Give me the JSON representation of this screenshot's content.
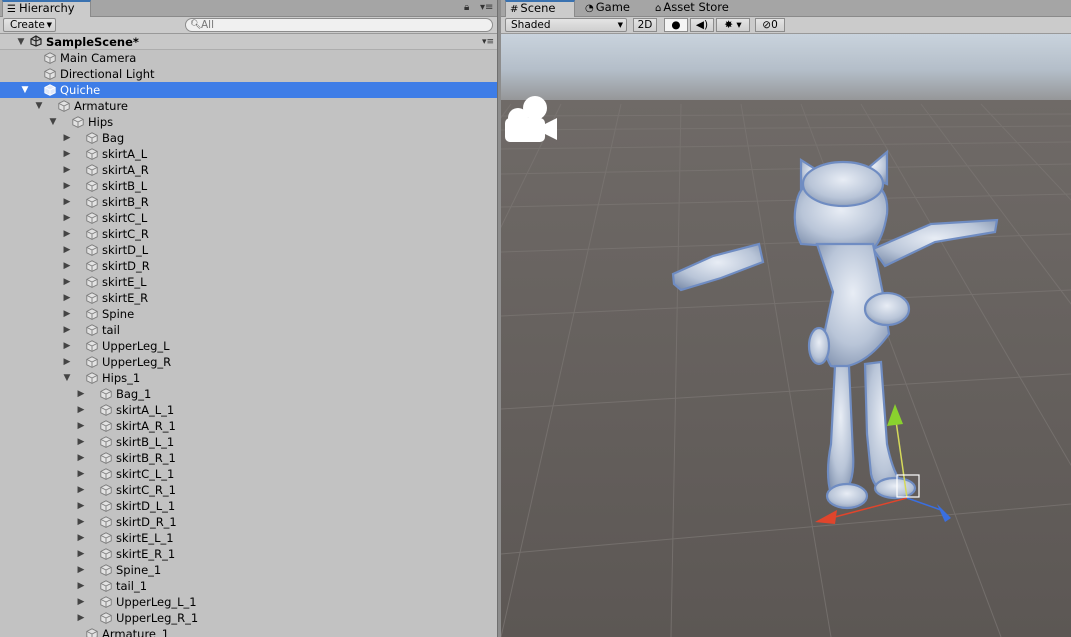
{
  "hierarchy": {
    "tab_label": "Hierarchy",
    "create_label": "Create",
    "search_placeholder": "All",
    "scene_name": "SampleScene*",
    "items": [
      {
        "label": "Main Camera",
        "depth": 1,
        "arrow": "none",
        "selected": false
      },
      {
        "label": "Directional Light",
        "depth": 1,
        "arrow": "none",
        "selected": false
      },
      {
        "label": "Quiche",
        "depth": 1,
        "arrow": "down",
        "selected": true
      },
      {
        "label": "Armature",
        "depth": 2,
        "arrow": "down",
        "selected": false
      },
      {
        "label": "Hips",
        "depth": 3,
        "arrow": "down",
        "selected": false
      },
      {
        "label": "Bag",
        "depth": 4,
        "arrow": "right",
        "selected": false
      },
      {
        "label": "skirtA_L",
        "depth": 4,
        "arrow": "right",
        "selected": false
      },
      {
        "label": "skirtA_R",
        "depth": 4,
        "arrow": "right",
        "selected": false
      },
      {
        "label": "skirtB_L",
        "depth": 4,
        "arrow": "right",
        "selected": false
      },
      {
        "label": "skirtB_R",
        "depth": 4,
        "arrow": "right",
        "selected": false
      },
      {
        "label": "skirtC_L",
        "depth": 4,
        "arrow": "right",
        "selected": false
      },
      {
        "label": "skirtC_R",
        "depth": 4,
        "arrow": "right",
        "selected": false
      },
      {
        "label": "skirtD_L",
        "depth": 4,
        "arrow": "right",
        "selected": false
      },
      {
        "label": "skirtD_R",
        "depth": 4,
        "arrow": "right",
        "selected": false
      },
      {
        "label": "skirtE_L",
        "depth": 4,
        "arrow": "right",
        "selected": false
      },
      {
        "label": "skirtE_R",
        "depth": 4,
        "arrow": "right",
        "selected": false
      },
      {
        "label": "Spine",
        "depth": 4,
        "arrow": "right",
        "selected": false
      },
      {
        "label": "tail",
        "depth": 4,
        "arrow": "right",
        "selected": false
      },
      {
        "label": "UpperLeg_L",
        "depth": 4,
        "arrow": "right",
        "selected": false
      },
      {
        "label": "UpperLeg_R",
        "depth": 4,
        "arrow": "right",
        "selected": false
      },
      {
        "label": "Hips_1",
        "depth": 4,
        "arrow": "down",
        "selected": false
      },
      {
        "label": "Bag_1",
        "depth": 5,
        "arrow": "right",
        "selected": false
      },
      {
        "label": "skirtA_L_1",
        "depth": 5,
        "arrow": "right",
        "selected": false
      },
      {
        "label": "skirtA_R_1",
        "depth": 5,
        "arrow": "right",
        "selected": false
      },
      {
        "label": "skirtB_L_1",
        "depth": 5,
        "arrow": "right",
        "selected": false
      },
      {
        "label": "skirtB_R_1",
        "depth": 5,
        "arrow": "right",
        "selected": false
      },
      {
        "label": "skirtC_L_1",
        "depth": 5,
        "arrow": "right",
        "selected": false
      },
      {
        "label": "skirtC_R_1",
        "depth": 5,
        "arrow": "right",
        "selected": false
      },
      {
        "label": "skirtD_L_1",
        "depth": 5,
        "arrow": "right",
        "selected": false
      },
      {
        "label": "skirtD_R_1",
        "depth": 5,
        "arrow": "right",
        "selected": false
      },
      {
        "label": "skirtE_L_1",
        "depth": 5,
        "arrow": "right",
        "selected": false
      },
      {
        "label": "skirtE_R_1",
        "depth": 5,
        "arrow": "right",
        "selected": false
      },
      {
        "label": "Spine_1",
        "depth": 5,
        "arrow": "right",
        "selected": false
      },
      {
        "label": "tail_1",
        "depth": 5,
        "arrow": "right",
        "selected": false
      },
      {
        "label": "UpperLeg_L_1",
        "depth": 5,
        "arrow": "right",
        "selected": false
      },
      {
        "label": "UpperLeg_R_1",
        "depth": 5,
        "arrow": "right",
        "selected": false
      },
      {
        "label": "Armature_1",
        "depth": 4,
        "arrow": "none",
        "selected": false
      }
    ]
  },
  "scene_view": {
    "tabs": [
      {
        "label": "Scene",
        "icon": "grid-icon",
        "active": true
      },
      {
        "label": "Game",
        "icon": "pacman-icon",
        "active": false
      },
      {
        "label": "Asset Store",
        "icon": "store-icon",
        "active": false
      }
    ],
    "shading_mode": "Shaded",
    "mode_2d_label": "2D",
    "hidden_count": "0"
  },
  "icons": {
    "hierarchy_tab": "list-icon",
    "lock": "lock-icon",
    "menu": "tab-menu-icon",
    "scene_object": "cube-icon",
    "unity_scene": "unity-logo-icon",
    "camera_gizmo": "camera-gizmo-icon",
    "lighting": "lightbulb-icon",
    "audio": "speaker-icon",
    "effects": "effects-icon",
    "visibility": "eye-slash-icon"
  },
  "colors": {
    "selection": "#3e7de7",
    "tab_accent": "#3a72b0",
    "panel_bg": "#c2c2c2",
    "viewport_ground": "#5f5a57",
    "viewport_sky": "#a5b3c1",
    "gizmo_x": "#e0452c",
    "gizmo_y": "#8ad12e",
    "gizmo_z": "#3a6fe0",
    "model_tint": "#b7c3d6"
  }
}
